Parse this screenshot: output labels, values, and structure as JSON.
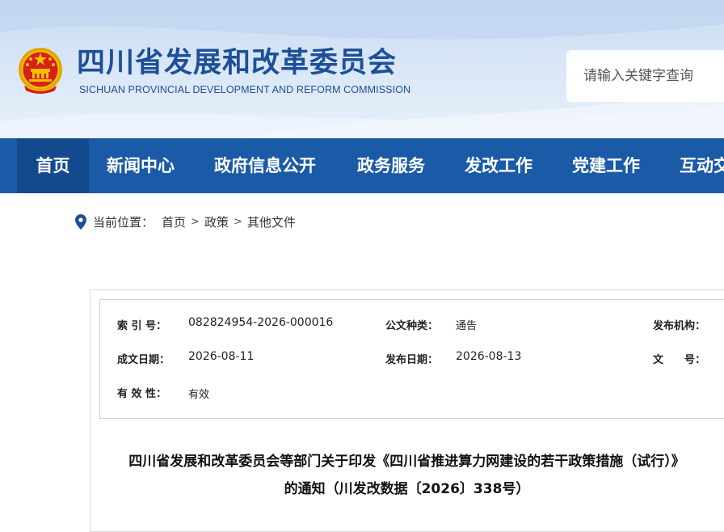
{
  "header": {
    "title": "四川省发展和改革委员会",
    "subtitle": "SICHUAN PROVINCIAL DEVELOPMENT AND REFORM COMMISSION",
    "emblem_icon": "national-emblem-icon",
    "search_placeholder": "请输入关键字查询"
  },
  "nav": {
    "items": [
      {
        "label": "首页"
      },
      {
        "label": "新闻中心"
      },
      {
        "label": "政府信息公开"
      },
      {
        "label": "政务服务"
      },
      {
        "label": "发改工作"
      },
      {
        "label": "党建工作"
      },
      {
        "label": "互动交"
      }
    ],
    "active_index": 0
  },
  "breadcrumb": {
    "label": "当前位置：",
    "items": [
      "首页",
      "政策",
      "其他文件"
    ],
    "separator": ">"
  },
  "meta": {
    "index_label": "索 引 号：",
    "index_value": "082824954-2026-000016",
    "type_label": "公文种类：",
    "type_value": "通告",
    "org_label": "发布机构：",
    "created_label": "成文日期：",
    "created_value": "2026-08-11",
    "published_label": "发布日期：",
    "published_value": "2026-08-13",
    "docno_label": "文　　号：",
    "validity_label": "有 效 性：",
    "validity_value": "有效"
  },
  "document": {
    "title_line1": "四川省发展和改革委员会等部门关于印发《四川省推进算力网建设的若干政策措施（试行）》",
    "title_line2": "的通知（川发改数据〔2026〕338号）"
  },
  "colors": {
    "brand_blue": "#1d4f99",
    "nav_bg": "#1a5aa6",
    "nav_active_bg": "#134a8e",
    "emblem_red": "#d6201f",
    "emblem_gold": "#f2c200"
  }
}
